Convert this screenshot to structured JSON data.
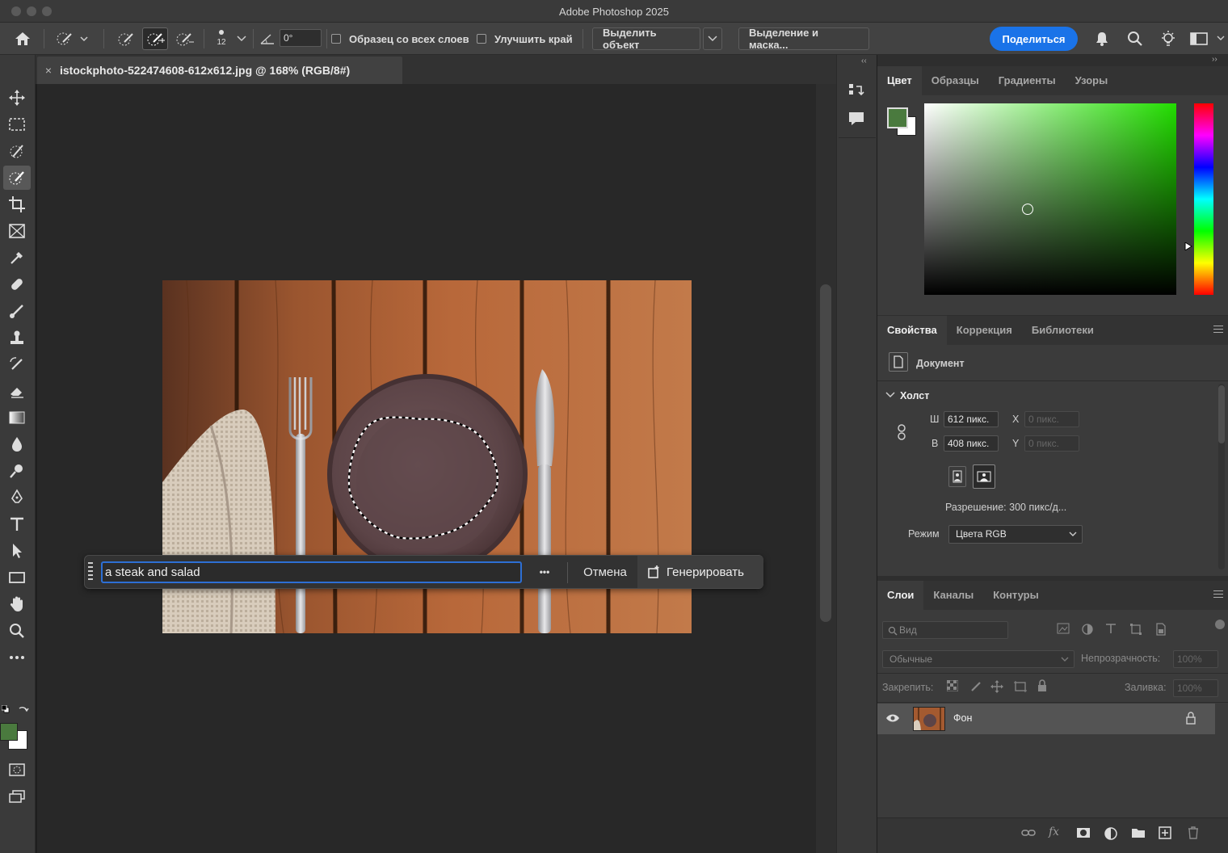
{
  "app": {
    "title": "Adobe Photoshop 2025"
  },
  "options": {
    "brush_size": "12",
    "angle": "0°",
    "sample_all_layers": "Образец со всех слоев",
    "enhance_edge": "Улучшить край",
    "select_subject": "Выделить объект",
    "select_mask": "Выделение и маска...",
    "share": "Поделиться"
  },
  "document": {
    "tab_title": "istockphoto-522474608-612x612.jpg @ 168% (RGB/8#)",
    "close": "×"
  },
  "generative_fill": {
    "prompt": "a steak and salad",
    "more": "•••",
    "cancel": "Отмена",
    "generate": "Генерировать"
  },
  "color_panel": {
    "tabs": [
      "Цвет",
      "Образцы",
      "Градиенты",
      "Узоры"
    ],
    "foreground": "#4a7a3e",
    "background": "#ffffff",
    "hue_color": "#22dd00"
  },
  "properties": {
    "tabs": [
      "Свойства",
      "Коррекция",
      "Библиотеки"
    ],
    "doc_label": "Документ",
    "canvas_section": "Холст",
    "w_label": "Ш",
    "w_value": "612 пикс.",
    "h_label": "В",
    "h_value": "408 пикс.",
    "x_label": "X",
    "x_value": "0 пикс.",
    "y_label": "Y",
    "y_value": "0 пикс.",
    "resolution": "Разрешение: 300 пикс/д...",
    "mode_label": "Режим",
    "mode_value": "Цвета RGB"
  },
  "layers": {
    "tabs": [
      "Слои",
      "Каналы",
      "Контуры"
    ],
    "search_placeholder": "Вид",
    "blend": "Обычные",
    "opacity_label": "Непрозрачность:",
    "opacity_value": "100%",
    "lock_label": "Закрепить:",
    "fill_label": "Заливка:",
    "fill_value": "100%",
    "items": [
      {
        "name": "Фон",
        "visible": true,
        "locked": true
      }
    ]
  },
  "panel_collapse_left": "‹‹",
  "panel_collapse_right": "››"
}
